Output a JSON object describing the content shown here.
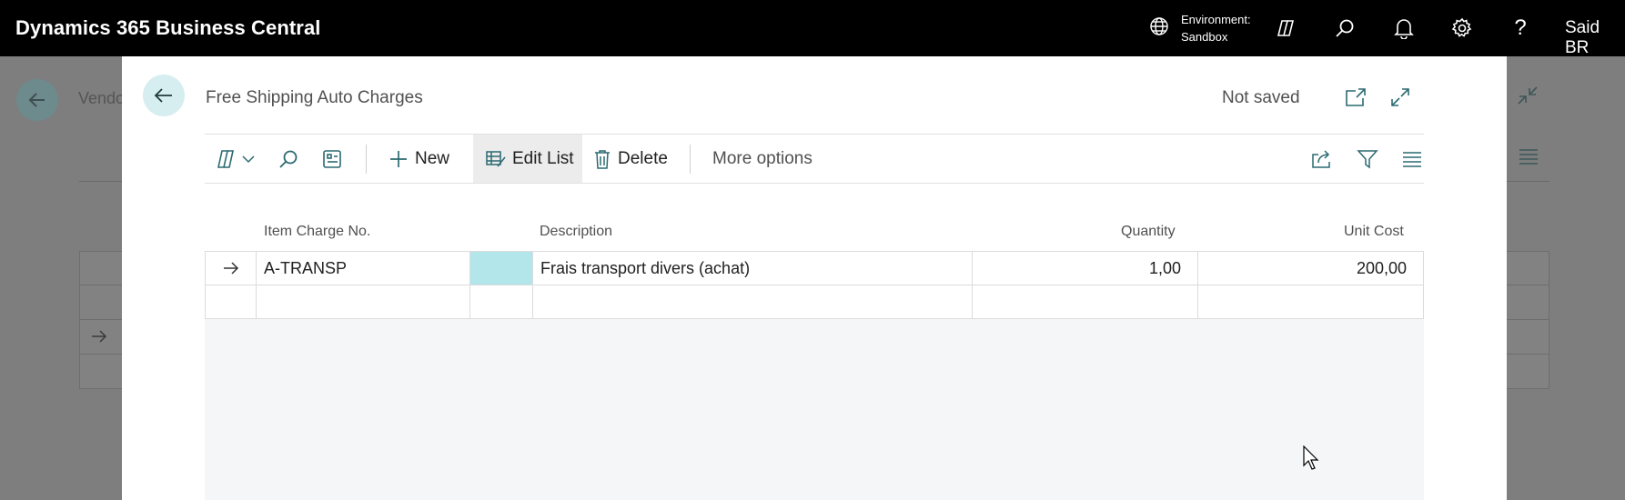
{
  "topbar": {
    "app_title": "Dynamics 365 Business Central",
    "env_label": "Environment:",
    "env_value": "Sandbox",
    "user": "Said BR"
  },
  "background_page": {
    "title_fragment": "Vendo"
  },
  "modal": {
    "title": "Free Shipping Auto Charges",
    "status": "Not saved",
    "toolbar": {
      "new_label": "New",
      "edit_list_label": "Edit List",
      "delete_label": "Delete",
      "more_options_label": "More options"
    },
    "columns": {
      "item_charge_no": "Item Charge No.",
      "description": "Description",
      "quantity": "Quantity",
      "unit_cost": "Unit Cost"
    },
    "rows": [
      {
        "item_charge_no": "A-TRANSP",
        "description": "Frais transport divers (achat)",
        "quantity": "1,00",
        "unit_cost": "200,00"
      },
      {
        "item_charge_no": "",
        "description": "",
        "quantity": "",
        "unit_cost": ""
      }
    ]
  },
  "colors": {
    "topbar_bg": "#000000",
    "accent_light": "#d6eef0",
    "selected_cell": "#b2e6ea"
  }
}
